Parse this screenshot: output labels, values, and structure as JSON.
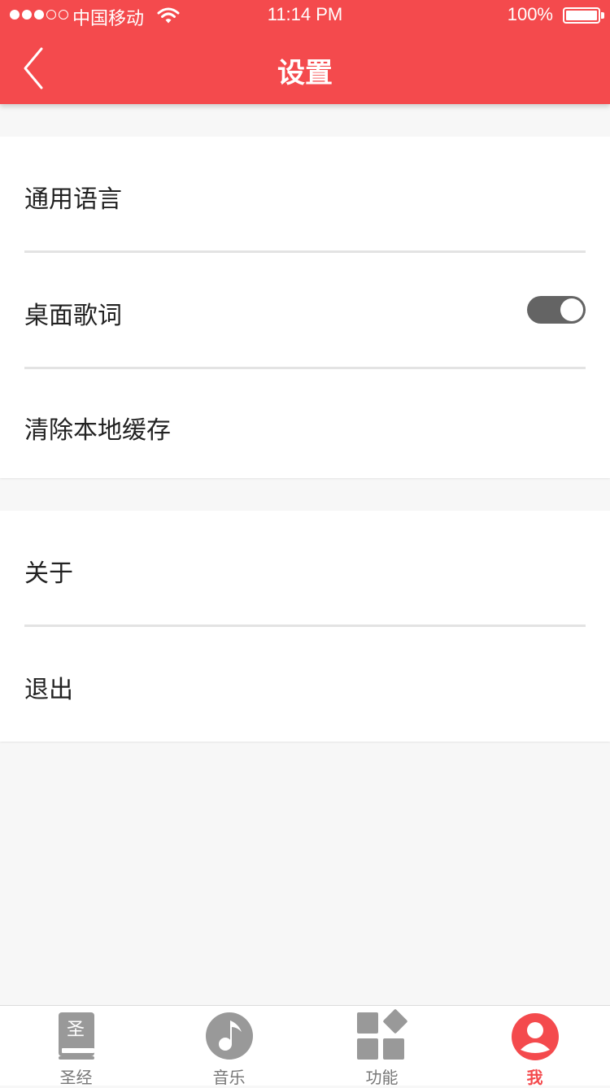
{
  "status_bar": {
    "carrier": "中国移动",
    "time": "11:14 PM",
    "battery": "100%",
    "signal_bars_filled": 3,
    "signal_bars_total": 5
  },
  "header": {
    "title": "设置",
    "back_icon": "chevron-left-icon",
    "background_color": "#f44a4d"
  },
  "settings": {
    "group1": [
      {
        "label": "通用语言"
      },
      {
        "label": "桌面歌词",
        "toggle_on": true
      },
      {
        "label": "清除本地缓存"
      }
    ],
    "group2": [
      {
        "label": "关于"
      },
      {
        "label": "退出"
      }
    ]
  },
  "tabbar": {
    "tabs": [
      {
        "label": "圣经",
        "icon": "bible-book-icon",
        "icon_text": "圣"
      },
      {
        "label": "音乐",
        "icon": "music-note-icon"
      },
      {
        "label": "功能",
        "icon": "features-grid-icon"
      },
      {
        "label": "我",
        "icon": "profile-icon",
        "active": true
      }
    ],
    "active_color": "#f44a4d",
    "inactive_color": "#999999"
  }
}
